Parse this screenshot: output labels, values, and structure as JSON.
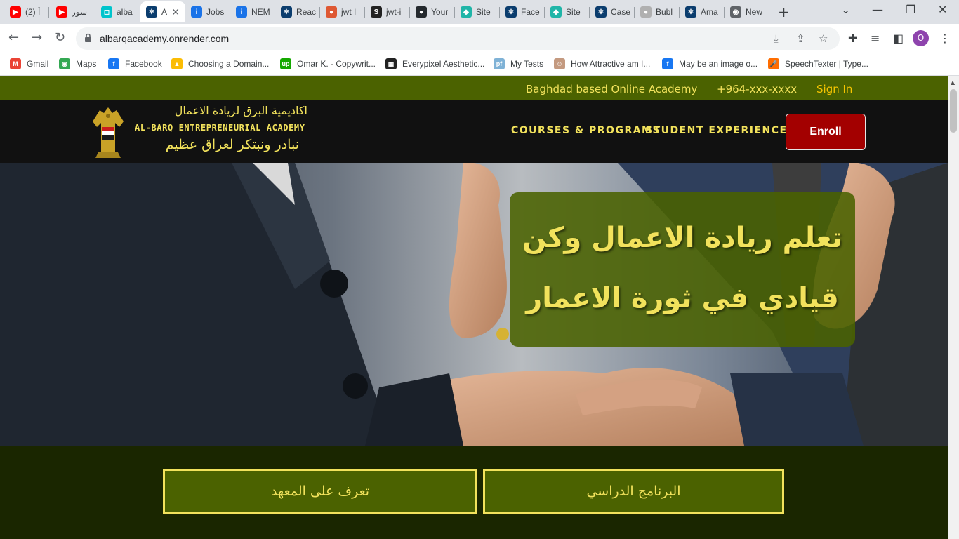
{
  "browser": {
    "tabs": [
      {
        "title": "(2) أ",
        "favicon": "youtube-icon",
        "color": "#ff0000",
        "glyph": "▶"
      },
      {
        "title": "سور",
        "favicon": "youtube-icon",
        "color": "#ff0000",
        "glyph": "▶"
      },
      {
        "title": "alba",
        "favicon": "render-icon",
        "color": "#00c4cc",
        "glyph": "◻"
      },
      {
        "title": "A",
        "favicon": "react-icon",
        "color": "#0b3d6e",
        "glyph": "⚛"
      },
      {
        "title": "Jobs",
        "favicon": "info-icon",
        "color": "#1a73e8",
        "glyph": "i"
      },
      {
        "title": "NEM",
        "favicon": "info-icon",
        "color": "#1a73e8",
        "glyph": "i"
      },
      {
        "title": "Reac",
        "favicon": "react-icon",
        "color": "#0b3d6e",
        "glyph": "⚛"
      },
      {
        "title": "jwt I",
        "favicon": "duckduckgo-icon",
        "color": "#de5833",
        "glyph": "●"
      },
      {
        "title": "jwt-i",
        "favicon": "stackedit-icon",
        "color": "#222222",
        "glyph": "S"
      },
      {
        "title": "Your",
        "favicon": "github-icon",
        "color": "#24292e",
        "glyph": "●"
      },
      {
        "title": "Site",
        "favicon": "netlify-icon",
        "color": "#20b5a8",
        "glyph": "◆"
      },
      {
        "title": "Face",
        "favicon": "react-icon",
        "color": "#0b3d6e",
        "glyph": "⚛"
      },
      {
        "title": "Site",
        "favicon": "netlify-icon",
        "color": "#20b5a8",
        "glyph": "◆"
      },
      {
        "title": "Case",
        "favicon": "react-icon",
        "color": "#0b3d6e",
        "glyph": "⚛"
      },
      {
        "title": "Bubl",
        "favicon": "bubble-icon",
        "color": "#b0b0b0",
        "glyph": "●"
      },
      {
        "title": "Ama",
        "favicon": "react-icon",
        "color": "#0b3d6e",
        "glyph": "⚛"
      },
      {
        "title": "New",
        "favicon": "chrome-icon",
        "color": "#5f6368",
        "glyph": "◉"
      }
    ],
    "close_tab_glyph": "✕",
    "new_tab_glyph": "+",
    "window_controls": {
      "dropdown": "⌄",
      "minimize": "—",
      "restore": "❐",
      "close": "✕"
    },
    "url": "albarqacademy.onrender.com",
    "profile_initial": "O",
    "bookmarks": [
      {
        "label": "Gmail",
        "icon": "gmail-icon",
        "color": "#ea4335",
        "glyph": "M"
      },
      {
        "label": "Maps",
        "icon": "maps-icon",
        "color": "#34a853",
        "glyph": "◉"
      },
      {
        "label": "Facebook",
        "icon": "facebook-icon",
        "color": "#1877f2",
        "glyph": "f"
      },
      {
        "label": "Choosing a Domain...",
        "icon": "drive-icon",
        "color": "#fbbc04",
        "glyph": "▲"
      },
      {
        "label": "Omar K. - Copywrit...",
        "icon": "upwork-icon",
        "color": "#14a800",
        "glyph": "up"
      },
      {
        "label": "Everypixel Aesthetic...",
        "icon": "everypixel-icon",
        "color": "#222222",
        "glyph": "▦"
      },
      {
        "label": "My Tests",
        "icon": "pf-icon",
        "color": "#7fb2d6",
        "glyph": "pf"
      },
      {
        "label": "How Attractive am I...",
        "icon": "face-photo-icon",
        "color": "#c49a80",
        "glyph": "☺"
      },
      {
        "label": "May be an image o...",
        "icon": "facebook-icon",
        "color": "#1877f2",
        "glyph": "f"
      },
      {
        "label": "SpeechTexter | Type...",
        "icon": "speechtexter-icon",
        "color": "#ff6d00",
        "glyph": "🎤"
      }
    ]
  },
  "site": {
    "topbar": {
      "tagline": "Baghdad based Online Academy",
      "phone": "+964-xxx-xxxx",
      "signin": "Sign In"
    },
    "brand": {
      "arabic_name": "اكاديمية البرق لريادة الاعمال",
      "english_name": "AL-BARQ ENTREPRENEURIAL ACADEMY",
      "arabic_slogan": "نبادر ونبتكر لعراق عظيم"
    },
    "nav": {
      "courses": "COURSES & PROGRAMS",
      "experience": "STUDENT EXPERIENCE"
    },
    "enroll_label": "Enroll",
    "hero": {
      "line1": "تعلم ريادة الاعمال وكن",
      "line2": "قيادي في ثورة الاعمار"
    },
    "cta": {
      "about": "تعرف على المعهد",
      "program": "البرنامج الدراسي"
    },
    "colors": {
      "olive": "#4b6200",
      "yellow": "#f2e25c",
      "enroll_red": "#a30000",
      "dark_bottom": "#1a2600"
    }
  }
}
